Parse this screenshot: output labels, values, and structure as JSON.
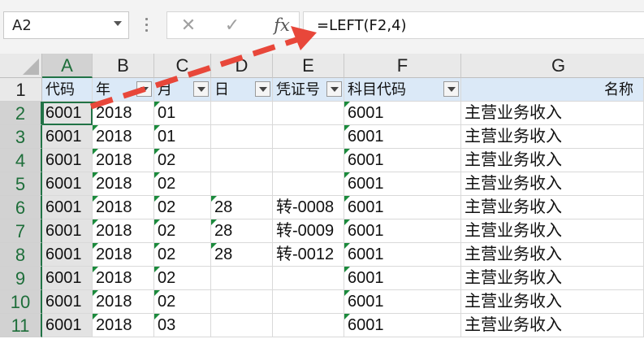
{
  "name_box": "A2",
  "formula": "=LEFT(F2,4)",
  "fx_label": "fx",
  "columns": [
    "A",
    "B",
    "C",
    "D",
    "E",
    "F",
    "G"
  ],
  "rows": [
    [
      "代码",
      "年",
      "月",
      "日",
      "凭证号",
      "科目代码",
      "名称"
    ],
    [
      "6001",
      "2018",
      "01",
      "",
      "",
      "6001",
      "主营业务收入"
    ],
    [
      "6001",
      "2018",
      "01",
      "",
      "",
      "6001",
      "主营业务收入"
    ],
    [
      "6001",
      "2018",
      "02",
      "",
      "",
      "6001",
      "主营业务收入"
    ],
    [
      "6001",
      "2018",
      "02",
      "",
      "",
      "6001",
      "主营业务收入"
    ],
    [
      "6001",
      "2018",
      "02",
      "28",
      "转-0008",
      "6001",
      "主营业务收入"
    ],
    [
      "6001",
      "2018",
      "02",
      "28",
      "转-0009",
      "6001",
      "主营业务收入"
    ],
    [
      "6001",
      "2018",
      "02",
      "28",
      "转-0012",
      "6001",
      "主营业务收入"
    ],
    [
      "6001",
      "2018",
      "02",
      "",
      "",
      "6001",
      "主营业务收入"
    ],
    [
      "6001",
      "2018",
      "02",
      "",
      "",
      "6001",
      "主营业务收入"
    ],
    [
      "6001",
      "2018",
      "03",
      "",
      "",
      "6001",
      "主营业务收入"
    ]
  ],
  "row_numbers": [
    "1",
    "2",
    "3",
    "4",
    "5",
    "6",
    "7",
    "8",
    "9",
    "10",
    "11"
  ],
  "colors": {
    "accent_green": "#217346",
    "annotation_arrow": "#e8473a",
    "header_fill": "#dbe9f7"
  }
}
